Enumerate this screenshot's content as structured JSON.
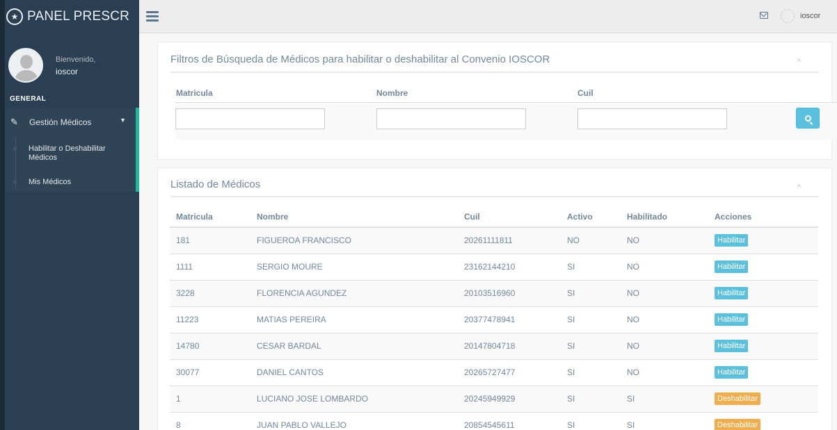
{
  "sidebar": {
    "brand": "PANEL PRESCR",
    "logo_icon": "sitemap-icon",
    "welcome": "Bienvenido,",
    "username": "ioscor",
    "section": "GENERAL",
    "menu": {
      "label": "Gestión Médicos",
      "items": [
        {
          "label": "Habilitar o Deshabilitar Médicos"
        },
        {
          "label": "Mis Médicos"
        }
      ]
    }
  },
  "topbar": {
    "username": "ioscor"
  },
  "filters": {
    "title": "Filtros de Búsqueda de Médicos para habilitar o deshabilitar al Convenio IOSCOR",
    "labels": {
      "matricula": "Matricula",
      "nombre": "Nombre",
      "cuil": "Cuil"
    },
    "values": {
      "matricula": "",
      "nombre": "",
      "cuil": ""
    }
  },
  "listado": {
    "title": "Listado de Médicos",
    "columns": [
      "Matricula",
      "Nombre",
      "Cuil",
      "Activo",
      "Habilitado",
      "Acciones"
    ],
    "rows": [
      {
        "matricula": "181",
        "nombre": "FIGUEROA FRANCISCO",
        "cuil": "20261111811",
        "activo": "NO",
        "habilitado": "NO",
        "accion": "Habilitar",
        "accion_type": "hab"
      },
      {
        "matricula": "1111",
        "nombre": "SERGIO MOURE",
        "cuil": "23162144210",
        "activo": "SI",
        "habilitado": "NO",
        "accion": "Habilitar",
        "accion_type": "hab"
      },
      {
        "matricula": "3228",
        "nombre": "FLORENCIA AGUNDEZ",
        "cuil": "20103516960",
        "activo": "SI",
        "habilitado": "NO",
        "accion": "Habilitar",
        "accion_type": "hab"
      },
      {
        "matricula": "11223",
        "nombre": "MATIAS PEREIRA",
        "cuil": "20377478941",
        "activo": "SI",
        "habilitado": "NO",
        "accion": "Habilitar",
        "accion_type": "hab"
      },
      {
        "matricula": "14780",
        "nombre": "CESAR BARDAL",
        "cuil": "20147804718",
        "activo": "SI",
        "habilitado": "NO",
        "accion": "Habilitar",
        "accion_type": "hab"
      },
      {
        "matricula": "30077",
        "nombre": "DANIEL CANTOS",
        "cuil": "20265727477",
        "activo": "SI",
        "habilitado": "NO",
        "accion": "Habilitar",
        "accion_type": "hab"
      },
      {
        "matricula": "1",
        "nombre": "LUCIANO JOSE LOMBARDO",
        "cuil": "20245949929",
        "activo": "SI",
        "habilitado": "SI",
        "accion": "Deshabilitar",
        "accion_type": "des"
      },
      {
        "matricula": "8",
        "nombre": "JUAN PABLO VALLEJO",
        "cuil": "20854545611",
        "activo": "SI",
        "habilitado": "SI",
        "accion": "Deshabilitar",
        "accion_type": "des"
      }
    ]
  },
  "colors": {
    "sidebar": "#2A3F54",
    "accent": "#1ABB9C",
    "info": "#5BC0DE",
    "warning": "#F0AD4E"
  }
}
